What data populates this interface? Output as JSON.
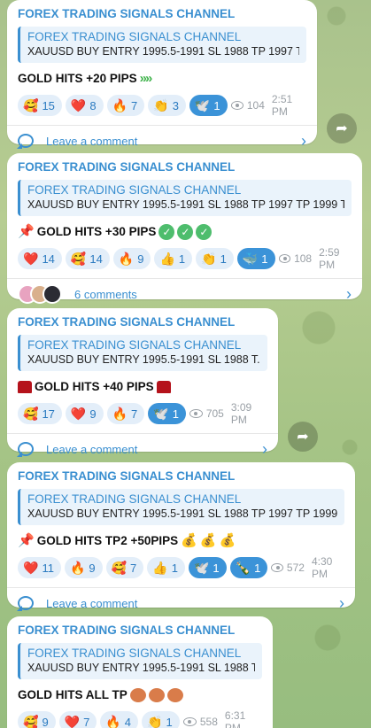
{
  "messages": [
    {
      "channel": "FOREX TRADING SIGNALS CHANNEL",
      "quote_title": "FOREX TRADING SIGNALS CHANNEL",
      "quote_text": "XAUUSD BUY   ENTRY 1995.5-1991 SL 1988 TP 1997 T...",
      "headline": "GOLD HITS +20 PIPS",
      "reactions": [
        {
          "emoji": "🥰",
          "count": "15",
          "active": false
        },
        {
          "emoji": "❤️",
          "count": "8",
          "active": false
        },
        {
          "emoji": "🔥",
          "count": "7",
          "active": false
        },
        {
          "emoji": "👏",
          "count": "3",
          "active": false
        },
        {
          "emoji": "🕊️",
          "count": "1",
          "active": true
        }
      ],
      "views": "104",
      "time": "2:51 PM",
      "comment_label": "Leave a comment"
    },
    {
      "channel": "FOREX TRADING SIGNALS CHANNEL",
      "quote_title": "FOREX TRADING SIGNALS CHANNEL",
      "quote_text": "XAUUSD BUY   ENTRY 1995.5-1991 SL 1988 TP 1997 TP 1999 T...",
      "headline": "GOLD HITS +30 PIPS",
      "reactions": [
        {
          "emoji": "❤️",
          "count": "14",
          "active": false
        },
        {
          "emoji": "🥰",
          "count": "14",
          "active": false
        },
        {
          "emoji": "🔥",
          "count": "9",
          "active": false
        },
        {
          "emoji": "👍",
          "count": "1",
          "active": false
        },
        {
          "emoji": "👏",
          "count": "1",
          "active": false
        },
        {
          "emoji": "🐳",
          "count": "1",
          "active": true
        }
      ],
      "views": "108",
      "time": "2:59 PM",
      "comment_label": "6 comments"
    },
    {
      "channel": "FOREX TRADING SIGNALS CHANNEL",
      "quote_title": "FOREX TRADING SIGNALS CHANNEL",
      "quote_text": "XAUUSD BUY   ENTRY 1995.5-1991 SL 1988 T...",
      "headline": "GOLD HITS +40 PIPS",
      "reactions": [
        {
          "emoji": "🥰",
          "count": "17",
          "active": false
        },
        {
          "emoji": "❤️",
          "count": "9",
          "active": false
        },
        {
          "emoji": "🔥",
          "count": "7",
          "active": false
        },
        {
          "emoji": "🕊️",
          "count": "1",
          "active": true
        }
      ],
      "views": "705",
      "time": "3:09 PM",
      "comment_label": "Leave a comment"
    },
    {
      "channel": "FOREX TRADING SIGNALS CHANNEL",
      "quote_title": "FOREX TRADING SIGNALS CHANNEL",
      "quote_text": "XAUUSD BUY   ENTRY 1995.5-1991 SL 1988 TP 1997 TP 1999 ...",
      "headline": "GOLD HITS TP2 +50PIPS",
      "reactions": [
        {
          "emoji": "❤️",
          "count": "11",
          "active": false
        },
        {
          "emoji": "🔥",
          "count": "9",
          "active": false
        },
        {
          "emoji": "🥰",
          "count": "7",
          "active": false
        },
        {
          "emoji": "👍",
          "count": "1",
          "active": false
        },
        {
          "emoji": "🕊️",
          "count": "1",
          "active": true
        },
        {
          "emoji": "🍾",
          "count": "1",
          "active": true
        }
      ],
      "views": "572",
      "time": "4:30 PM",
      "comment_label": "Leave a comment"
    },
    {
      "channel": "FOREX TRADING SIGNALS CHANNEL",
      "quote_title": "FOREX TRADING SIGNALS CHANNEL",
      "quote_text": "XAUUSD BUY   ENTRY 1995.5-1991 SL 1988 T...",
      "headline": "GOLD HITS ALL TP",
      "reactions": [
        {
          "emoji": "🥰",
          "count": "9",
          "active": false
        },
        {
          "emoji": "❤️",
          "count": "7",
          "active": false
        },
        {
          "emoji": "🔥",
          "count": "4",
          "active": false
        },
        {
          "emoji": "👏",
          "count": "1",
          "active": false
        }
      ],
      "views": "558",
      "time": "6:31 PM"
    }
  ],
  "icons": {
    "eye": "views-eye-icon",
    "comment": "comment-bubble-icon",
    "share": "share-arrow-icon",
    "chevron": "chevron-right-icon"
  },
  "colors": {
    "accent": "#3a8fd0",
    "active_reaction": "#3b93d8",
    "reaction_bg": "#e3eef9",
    "background": "#a9c28c"
  }
}
